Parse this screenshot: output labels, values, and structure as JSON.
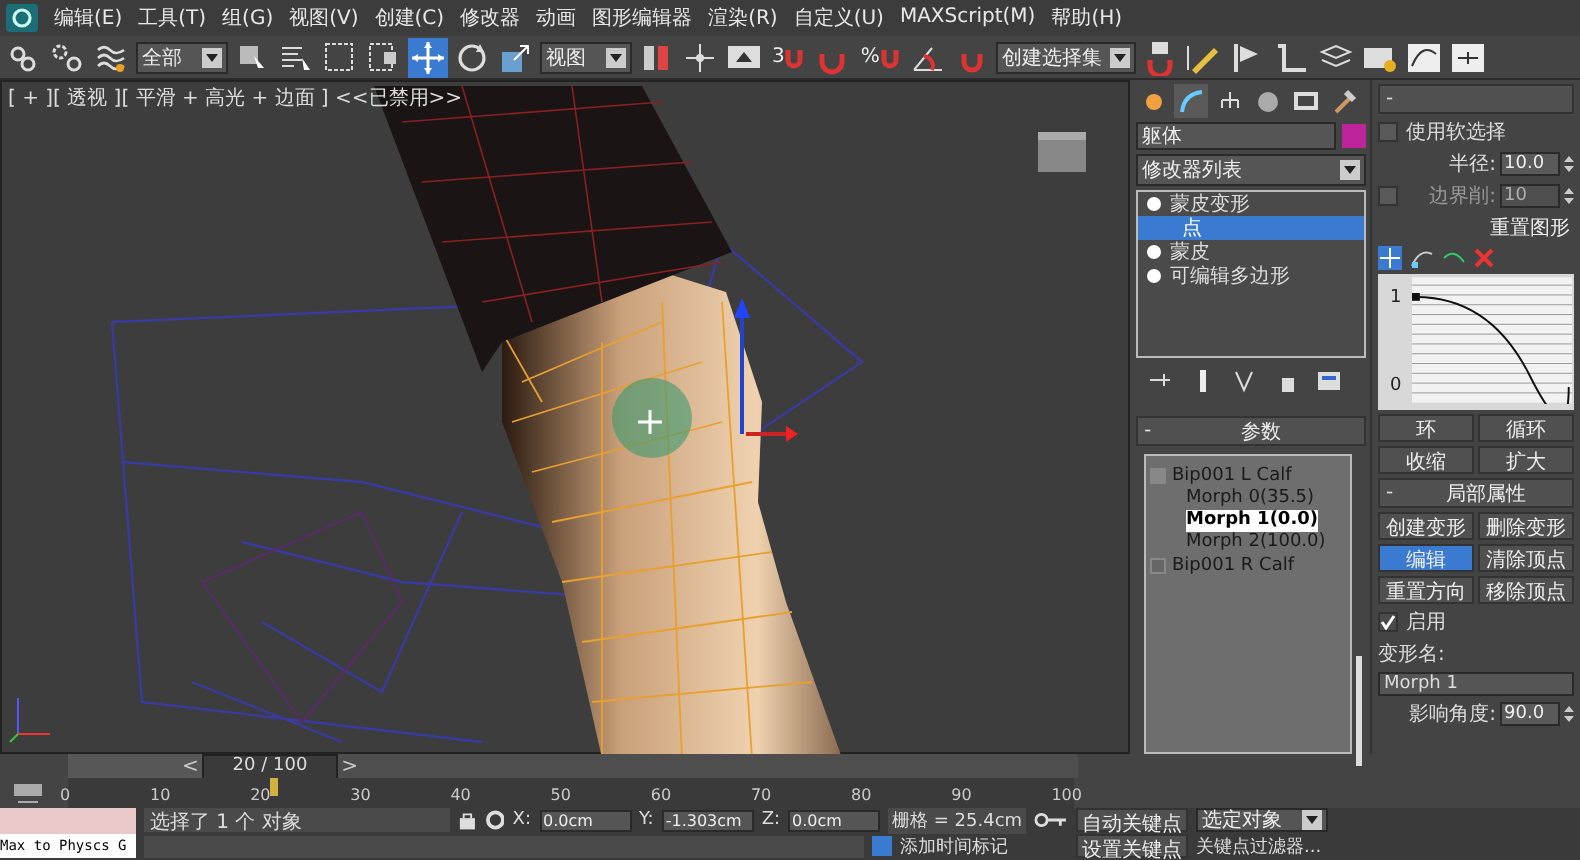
{
  "menubar": {
    "items": [
      "编辑(E)",
      "工具(T)",
      "组(G)",
      "视图(V)",
      "创建(C)",
      "修改器",
      "动画",
      "图形编辑器",
      "渲染(R)",
      "自定义(U)",
      "MAXScript(M)",
      "帮助(H)"
    ]
  },
  "toolbar": [
    {
      "kind": "tool",
      "selected": false
    },
    {
      "kind": "tool",
      "selected": false
    },
    {
      "kind": "tool",
      "selected": false
    },
    {
      "kind": "dropdown",
      "value": "全部"
    },
    {
      "kind": "tool",
      "selected": false
    },
    {
      "kind": "tool",
      "selected": false
    },
    {
      "kind": "tool",
      "selected": false
    },
    {
      "kind": "tool",
      "selected": false
    },
    {
      "kind": "tool",
      "selected": true
    },
    {
      "kind": "tool",
      "selected": false
    },
    {
      "kind": "tool",
      "selected": false
    },
    {
      "kind": "dropdown",
      "value": "视图"
    },
    {
      "kind": "tool",
      "selected": false
    },
    {
      "kind": "tool",
      "selected": false
    },
    {
      "kind": "tool",
      "selected": false
    },
    {
      "kind": "snap",
      "label": "3"
    },
    {
      "kind": "tool",
      "selected": false
    },
    {
      "kind": "snap",
      "label": "%"
    },
    {
      "kind": "tool",
      "selected": false
    },
    {
      "kind": "tool",
      "selected": false
    },
    {
      "kind": "dropdown",
      "value": "创建选择集"
    },
    {
      "kind": "tool",
      "selected": false
    },
    {
      "kind": "tool",
      "selected": false
    },
    {
      "kind": "tool",
      "selected": false
    },
    {
      "kind": "tool",
      "selected": false
    },
    {
      "kind": "tool",
      "selected": false
    },
    {
      "kind": "tool",
      "selected": false
    },
    {
      "kind": "tool",
      "selected": false
    },
    {
      "kind": "tool",
      "selected": false
    }
  ],
  "viewport": {
    "label": "[ + ][ 透视 ][ 平滑 + 高光 + 边面 ] <<已禁用>>"
  },
  "command_panel": {
    "tabs": [
      {
        "selected": false
      },
      {
        "selected": true
      },
      {
        "selected": false
      },
      {
        "selected": false
      },
      {
        "selected": false
      },
      {
        "selected": false
      }
    ],
    "object_name": "躯体",
    "modifier_list": "修改器列表",
    "stack": [
      {
        "label": "蒙皮变形",
        "selected": false,
        "children": [
          {
            "label": "点",
            "selected": true
          }
        ]
      },
      {
        "label": "蒙皮",
        "selected": false
      },
      {
        "label": "可编辑多边形",
        "selected": false
      }
    ],
    "parameters": {
      "sign": "-",
      "title": "参数",
      "tree": [
        {
          "label": "Bip001 L Calf",
          "expanded": true,
          "children": [
            {
              "label": "Morph 0(35.5)",
              "selected": false
            },
            {
              "label": "Morph 1(0.0)",
              "selected": true
            },
            {
              "label": "Morph 2(100.0)",
              "selected": false
            }
          ]
        },
        {
          "label": "Bip001 R Calf",
          "expanded": false
        }
      ]
    }
  },
  "soft_selection": {
    "sign": "-",
    "use_soft_selection": {
      "label": "使用软选择",
      "checked": false
    },
    "radius": {
      "label": "半径:",
      "value": "10.0",
      "disabled": false
    },
    "edge_limit": {
      "label": "边界削:",
      "value": "10",
      "checked": false,
      "disabled": true
    },
    "reset_button": "重置图形",
    "graph_ticks": [
      "1",
      "0"
    ],
    "buttons": [
      "环",
      "循环",
      "收缩",
      "扩大"
    ]
  },
  "local_properties": {
    "sign": "-",
    "title": "局部属性",
    "buttons": [
      {
        "label": "创建变形",
        "selected": false
      },
      {
        "label": "删除变形",
        "selected": false
      },
      {
        "label": "编辑",
        "selected": true
      },
      {
        "label": "清除顶点",
        "selected": false
      },
      {
        "label": "重置方向",
        "selected": false
      },
      {
        "label": "移除顶点",
        "selected": false
      }
    ],
    "enable": {
      "label": "启用",
      "checked": true
    },
    "morph_name_label": "变形名:",
    "morph_name": "Morph 1",
    "influence_label": "影响角度:",
    "influence": "90.0"
  },
  "timeline": {
    "prev": "<",
    "frame": "20 / 100",
    "next": ">",
    "level": 0.2,
    "ticks": [
      "0",
      "10",
      "20",
      "30",
      "40",
      "50",
      "60",
      "70",
      "80",
      "90",
      "100"
    ]
  },
  "status_bar": {
    "script_listener": "Max to Physcs G",
    "selection": "选择了 1 个 对象",
    "x_label": "X:",
    "x": "0.0cm",
    "y_label": "Y:",
    "y": "-1.303cm",
    "z_label": "Z:",
    "z": "0.0cm",
    "grid": "栅格 = 25.4cm",
    "auto_key": "自动关键点",
    "key_mode": "选定对象",
    "set_key": "设置关键点",
    "add_time_tag": "添加时间标记",
    "key_filters": "关键点过滤器..."
  }
}
